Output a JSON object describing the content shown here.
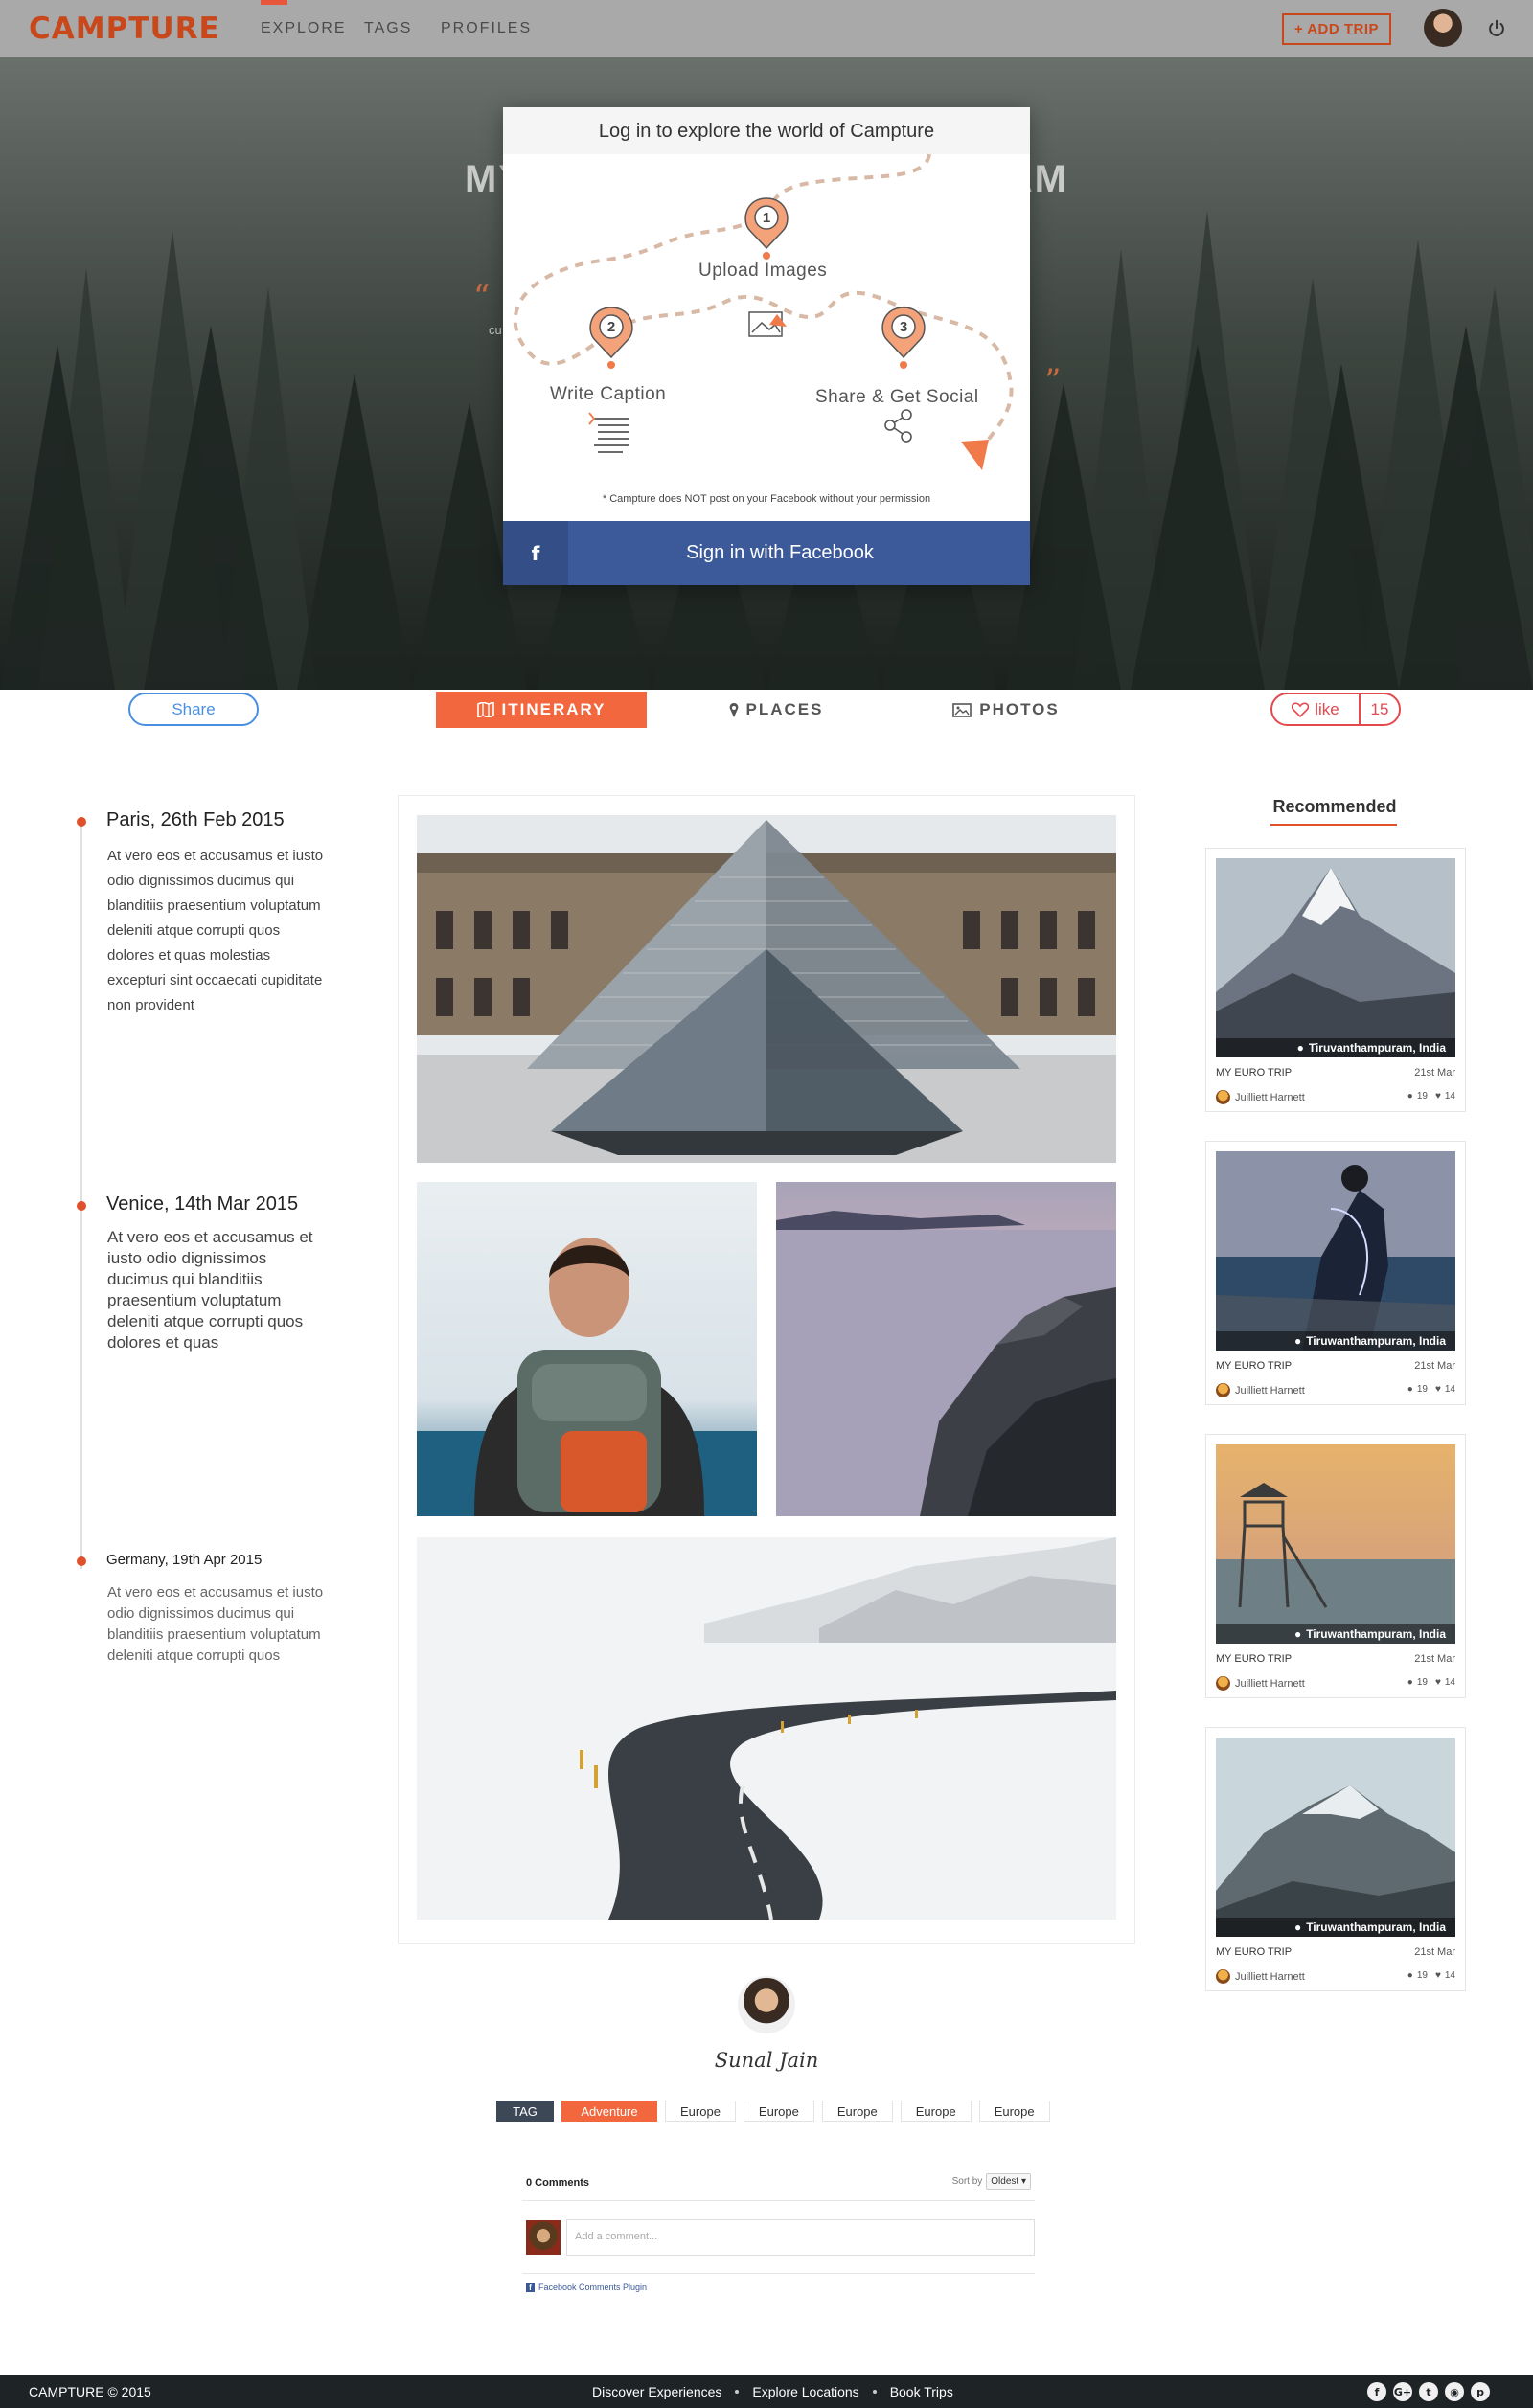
{
  "nav": {
    "logo": "CAMPTURE",
    "links": [
      "EXPLORE",
      "TAGS",
      "PROFILES"
    ],
    "active_link": "EXPLORE",
    "add_trip": "ADD TRIP",
    "accent": "#c8481b"
  },
  "hero": {
    "title_visible": "MY T",
    "title_visible_end": "RAM",
    "subtitle_fragment": "cu"
  },
  "modal": {
    "header": "Log in to explore the world of Campture",
    "steps": [
      {
        "num": "1",
        "label": "Upload Images",
        "icon": "image-icon"
      },
      {
        "num": "2",
        "label": "Write Caption",
        "icon": "caption-icon"
      },
      {
        "num": "3",
        "label": "Share & Get Social",
        "icon": "share-icon"
      }
    ],
    "note": "* Campture does NOT post on your Facebook without your permission",
    "fb_icon": "f",
    "fb_button": "Sign in with Facebook",
    "fb_color": "#3c5a9a"
  },
  "tabs": {
    "share": "Share",
    "items": [
      {
        "label": "ITINERARY",
        "icon": "map-icon",
        "active": true
      },
      {
        "label": "PLACES",
        "icon": "pin-icon",
        "active": false
      },
      {
        "label": "PHOTOS",
        "icon": "photo-icon",
        "active": false
      }
    ],
    "like_label": "like",
    "like_count": "15"
  },
  "timeline": [
    {
      "title": "Paris, 26th Feb 2015",
      "text": "At vero eos et accusamus et iusto odio dignissimos ducimus qui blanditiis praesentium voluptatum deleniti atque corrupti quos dolores et quas molestias excepturi sint occaecati cupiditate non provident"
    },
    {
      "title": "Venice, 14th Mar 2015",
      "text": "At vero eos et accusamus et iusto odio dignissimos ducimus qui blanditiis praesentium voluptatum deleniti atque corrupti quos dolores et quas"
    },
    {
      "title": "Germany, 19th Apr 2015",
      "text": "At vero eos et accusamus et iusto odio dignissimos ducimus qui blanditiis praesentium voluptatum deleniti atque corrupti quos"
    }
  ],
  "recommended": {
    "title": "Recommended",
    "cards": [
      {
        "location": "Tiruvanthampuram, India",
        "trip": "MY EURO TRIP",
        "date": "21st Mar",
        "author": "Juilliett Harnett",
        "comments": "19",
        "likes": "14"
      },
      {
        "location": "Tiruwanthampuram, India",
        "trip": "MY EURO TRIP",
        "date": "21st Mar",
        "author": "Juilliett Harnett",
        "comments": "19",
        "likes": "14"
      },
      {
        "location": "Tiruwanthampuram, India",
        "trip": "MY EURO TRIP",
        "date": "21st Mar",
        "author": "Juilliett Harnett",
        "comments": "19",
        "likes": "14"
      },
      {
        "location": "Tiruwanthampuram, India",
        "trip": "MY EURO TRIP",
        "date": "21st Mar",
        "author": "Juilliett Harnett",
        "comments": "19",
        "likes": "14"
      }
    ]
  },
  "author": {
    "name": "Sunal Jain"
  },
  "tags": {
    "label": "TAG",
    "items": [
      "Adventure",
      "Europe",
      "Europe",
      "Europe",
      "Europe",
      "Europe"
    ]
  },
  "comments": {
    "count": "0 Comments",
    "sort_label": "Sort by",
    "sort_value": "Oldest",
    "placeholder": "Add a comment...",
    "plugin": "Facebook Comments Plugin"
  },
  "footer": {
    "copyright": "CAMPTURE © 2015",
    "links": [
      "Discover Experiences",
      "Explore Locations",
      "Book Trips"
    ],
    "social": [
      "facebook-icon",
      "google-plus-icon",
      "twitter-icon",
      "instagram-icon",
      "pinterest-icon"
    ]
  }
}
